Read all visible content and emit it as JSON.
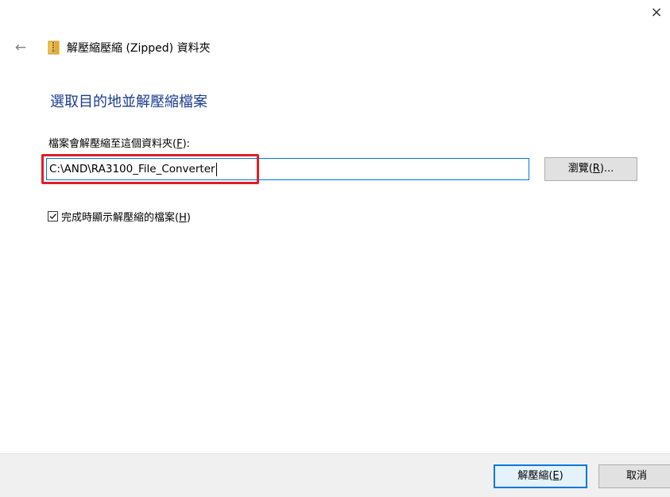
{
  "window": {
    "close_glyph": "×"
  },
  "header": {
    "back_glyph": "←",
    "icon": "zip-folder-icon",
    "title": "解壓縮壓縮 (Zipped) 資料夾"
  },
  "instruction": "選取目的地並解壓縮檔案",
  "destination": {
    "label_prefix": "檔案會解壓縮至這個資料夾(",
    "label_accel": "F",
    "label_suffix": "):",
    "value": "C:\\AND\\RA3100_File_Converter"
  },
  "browse_button": {
    "label_prefix": "瀏覽(",
    "label_accel": "R",
    "label_suffix": ")..."
  },
  "show_files_checkbox": {
    "checked": true,
    "label_prefix": "完成時顯示解壓縮的檔案(",
    "label_accel": "H",
    "label_suffix": ")"
  },
  "footer": {
    "extract_button": {
      "label_prefix": "解壓縮(",
      "label_accel": "E",
      "label_suffix": ")"
    },
    "cancel_button": {
      "label": "取消"
    }
  },
  "colors": {
    "instruction_blue": "#1a3c8e",
    "highlight_red": "#e01e24",
    "focus_blue": "#0078d7",
    "footer_bg": "#f0f0f0"
  }
}
